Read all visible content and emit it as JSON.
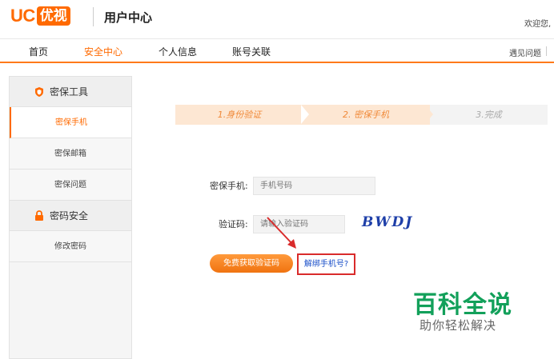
{
  "header": {
    "logo_uc": "UC",
    "logo_yoshi": "优视",
    "center_title": "用户中心",
    "welcome": "欢迎您,"
  },
  "nav": {
    "items": [
      "首页",
      "安全中心",
      "个人信息",
      "账号关联"
    ],
    "active": "安全中心",
    "help": "遇见问题"
  },
  "sidebar": {
    "group_tools": "密保工具",
    "item_phone": "密保手机",
    "item_email": "密保邮箱",
    "item_question": "密保问题",
    "group_pwd": "密码安全",
    "item_changepwd": "修改密码"
  },
  "steps": [
    "1.身份验证",
    "2. 密保手机",
    "3.完成"
  ],
  "form": {
    "phone_label": "密保手机:",
    "phone_placeholder": "手机号码",
    "code_label": "验证码:",
    "code_placeholder": "请输入验证码",
    "captcha_text": "BWDJ",
    "get_code_button": "免费获取验证码",
    "unbind_link": "解绑手机号?"
  },
  "watermark": {
    "title": "百科全说",
    "subtitle": "助你轻松解决"
  },
  "colors": {
    "accent": "#ff6a00",
    "highlight_box": "#d92b2b",
    "link": "#1a4fc9",
    "watermark": "#12a05a"
  }
}
